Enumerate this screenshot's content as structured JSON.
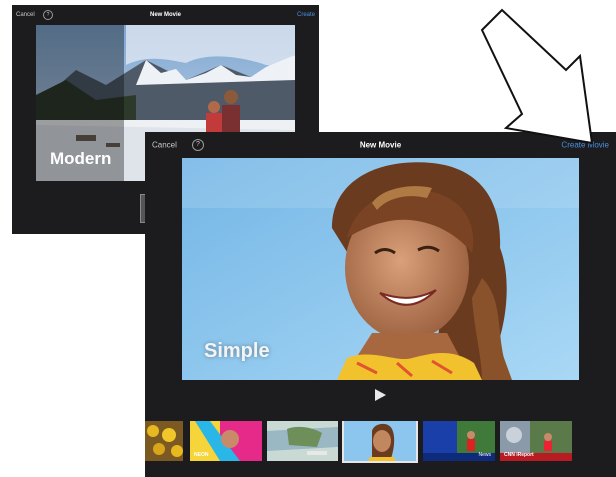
{
  "back_window": {
    "cancel_label": "Cancel",
    "help_icon": "question-circle-icon",
    "title": "New Movie",
    "create_label": "Create",
    "theme_name": "Modern"
  },
  "front_window": {
    "cancel_label": "Cancel",
    "help_icon": "question-circle-icon",
    "title": "New Movie",
    "create_label": "Create Movie",
    "theme_name": "Simple",
    "play_icon": "play-icon"
  },
  "theme_thumbnails": [
    {
      "label": "",
      "selected": false
    },
    {
      "label": "NEON",
      "selected": false
    },
    {
      "label": "",
      "selected": false
    },
    {
      "label": "",
      "selected": true
    },
    {
      "label": "News",
      "selected": false
    },
    {
      "label": "CNN iReport",
      "selected": false
    }
  ],
  "callout_icon": "arrow-down-right-icon",
  "colors": {
    "window_bg": "#1c1c1e",
    "accent": "#4a8fe0",
    "title_text": "#ffffff"
  }
}
